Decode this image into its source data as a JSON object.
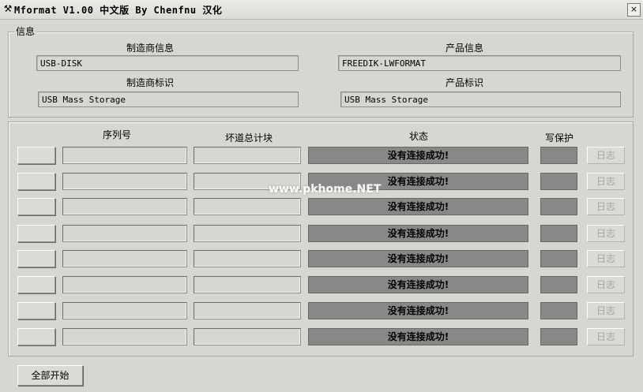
{
  "window": {
    "title": "Mformat V1.00 中文版 By Chenfnu 汉化",
    "close_label": "×"
  },
  "info": {
    "legend": "信息",
    "manufacturer_info_label": "制造商信息",
    "manufacturer_info_value": "USB-DISK",
    "product_info_label": "产品信息",
    "product_info_value": "FREEDIK-LWFORMAT",
    "manufacturer_id_label": "制造商标识",
    "manufacturer_id_value": "USB Mass Storage",
    "product_id_label": "产品标识",
    "product_id_value": "USB Mass Storage"
  },
  "table": {
    "headers": {
      "serial": "序列号",
      "bad_blocks": "坏道总计块",
      "status": "状态",
      "write_protect": "写保护"
    },
    "rows": [
      {
        "status": "没有连接成功!",
        "log": "日志"
      },
      {
        "status": "没有连接成功!",
        "log": "日志"
      },
      {
        "status": "没有连接成功!",
        "log": "日志"
      },
      {
        "status": "没有连接成功!",
        "log": "日志"
      },
      {
        "status": "没有连接成功!",
        "log": "日志"
      },
      {
        "status": "没有连接成功!",
        "log": "日志"
      },
      {
        "status": "没有连接成功!",
        "log": "日志"
      },
      {
        "status": "没有连接成功!",
        "log": "日志"
      }
    ]
  },
  "footer": {
    "start_all_label": "全部开始"
  },
  "watermark": "www.pkhome.NET",
  "icons": {
    "title": "hammer-icon",
    "close": "close-icon"
  }
}
